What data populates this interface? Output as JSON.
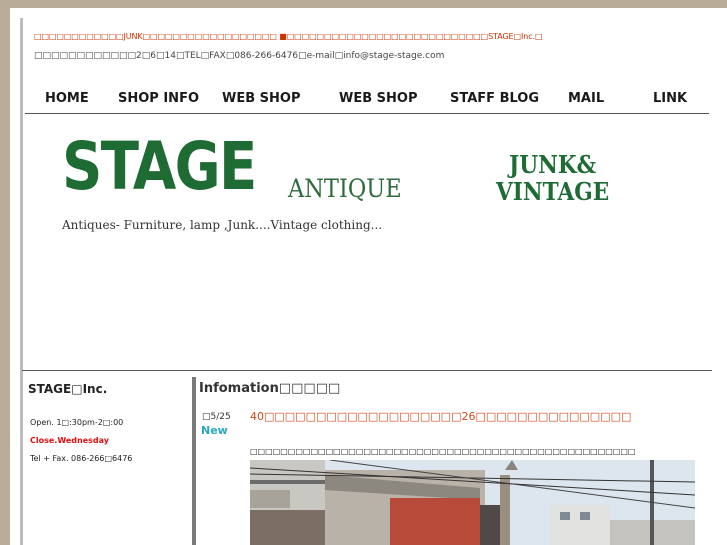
{
  "header": {
    "line1": "□□□□□□□□□□□□JUNK□□□□□□□□□□□□□□□□□□ ■□□□□□□□□□□□□□□□□□□□□□□□□□□□STAGE□Inc.□",
    "line2": "□□□□□□□□□□□□2□6□14□TEL□FAX□086-266-6476□e-mail□info@stage-stage.com"
  },
  "nav": [
    {
      "label": "HOME"
    },
    {
      "label": "SHOP INFO"
    },
    {
      "label": "WEB SHOP"
    },
    {
      "label": "WEB SHOP"
    },
    {
      "label": "STAFF BLOG"
    },
    {
      "label": "MAIL"
    },
    {
      "label": "LINK"
    }
  ],
  "banner": {
    "logo_stage": "STAGE",
    "logo_antique": "ANTIQUE",
    "logo_junk_line1": "JUNK&",
    "logo_junk_line2": "VINTAGE",
    "tagline": "Antiques- Furniture, lamp ,Junk....Vintage clothing..."
  },
  "sidebar": {
    "title": "STAGE□Inc.",
    "open": "Open. 1□:30pm-2□:00",
    "close": "Close.Wednesday",
    "tel": "Tel + Fax. 086-266□6476"
  },
  "info": {
    "title": "Infomation□□□□□",
    "date": "□5/25",
    "badge": "New",
    "post_title": "40□□□□□□□□□□□□□□□□□□□26□□□□□□□□□□□□□□□",
    "post_text": "□□□□□□□□□□□□□□□□□□□□□□□□□□□□□□□□□□□□□□□□□□□□□□□□□□□"
  },
  "colors": {
    "accent_green": "#1e6b33",
    "header_red": "#cc3300",
    "close_red": "#e01010",
    "new_cyan": "#29a8c4",
    "post_orange": "#d04a1a"
  }
}
